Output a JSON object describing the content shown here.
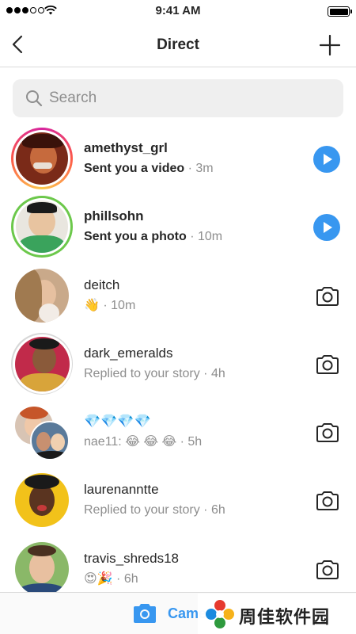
{
  "status_bar": {
    "time": "9:41 AM"
  },
  "nav": {
    "title": "Direct"
  },
  "search": {
    "placeholder": "Search"
  },
  "threads": [
    {
      "username": "amethyst_grl",
      "message": "Sent you a video",
      "time": " · 3m",
      "unread": true,
      "action": "play"
    },
    {
      "username": "phillsohn",
      "message": "Sent you a photo",
      "time": " · 10m",
      "unread": true,
      "action": "play"
    },
    {
      "username": "deitch",
      "message": "👋",
      "time": " · 10m",
      "unread": false,
      "action": "camera"
    },
    {
      "username": "dark_emeralds",
      "message": "Replied to your story",
      "time": " · 4h",
      "unread": false,
      "action": "camera"
    },
    {
      "username": "💎💎💎💎",
      "message": "nae11: 😂 😂 😂",
      "time": " · 5h",
      "unread": false,
      "action": "camera"
    },
    {
      "username": "laurenanntte",
      "message": "Replied to your story",
      "time": " · 6h",
      "unread": false,
      "action": "camera"
    },
    {
      "username": "travis_shreds18",
      "message": "😍🎉",
      "time": " · 6h",
      "unread": false,
      "action": "camera"
    }
  ],
  "bottom_bar": {
    "camera_label": "Camera"
  },
  "watermark": {
    "text": "周佳软件园"
  },
  "colors": {
    "accent": "#3897f0",
    "story_ring": "#d6249f",
    "close_friends_ring": "#6cc84b",
    "text": "#262626",
    "secondary_text": "#8e8e8e"
  },
  "icons": [
    "back-arrow-icon",
    "plus-icon",
    "search-icon",
    "play-icon",
    "camera-icon"
  ]
}
